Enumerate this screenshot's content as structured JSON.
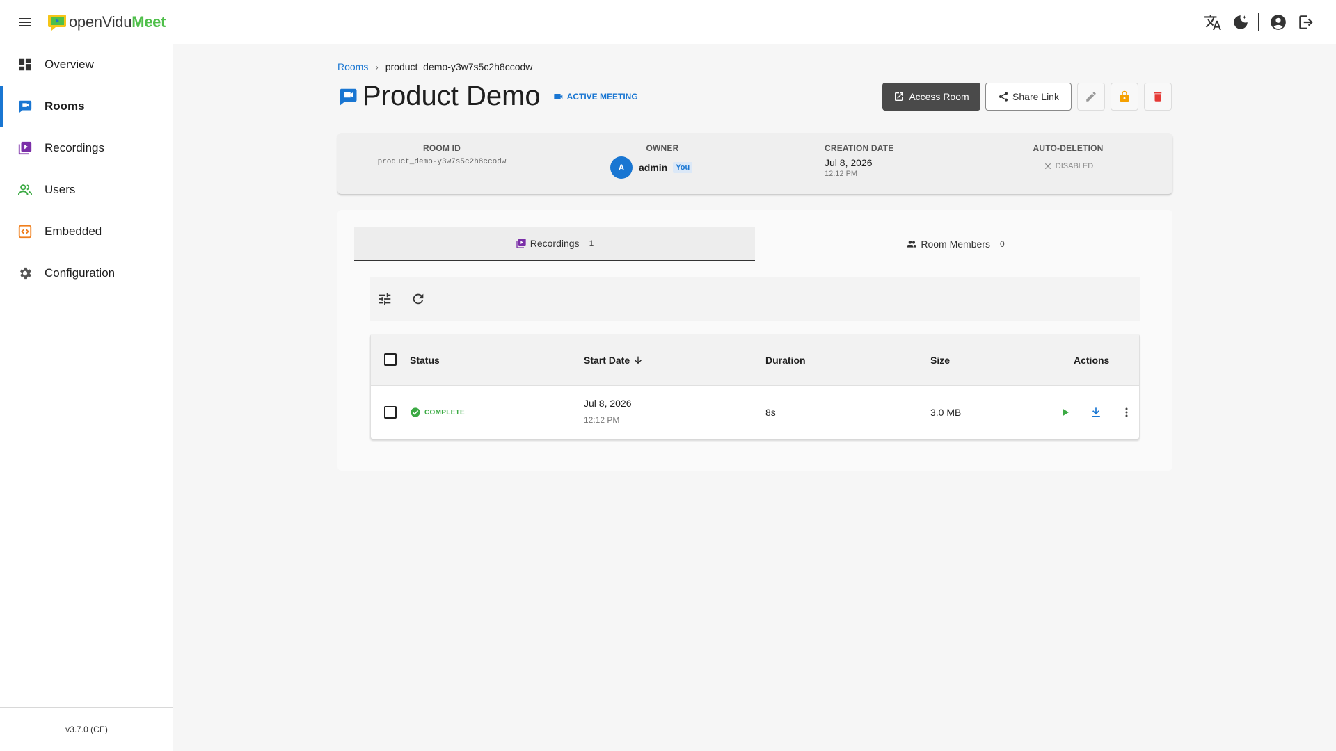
{
  "app": {
    "logo_text_plain": "openVidu",
    "logo_text_bold": "Meet",
    "version": "v3.7.0 (CE)"
  },
  "topbar": {
    "icons": [
      "menu-icon",
      "translate-icon",
      "theme-toggle-icon",
      "account-icon",
      "logout-icon"
    ]
  },
  "sidebar": {
    "items": [
      {
        "label": "Overview",
        "icon": "dashboard-icon",
        "active": false
      },
      {
        "label": "Rooms",
        "icon": "chat-room-icon",
        "active": true
      },
      {
        "label": "Recordings",
        "icon": "video-library-icon",
        "active": false
      },
      {
        "label": "Users",
        "icon": "users-icon",
        "active": false
      },
      {
        "label": "Embedded",
        "icon": "code-icon",
        "active": false
      },
      {
        "label": "Configuration",
        "icon": "gear-icon",
        "active": false
      }
    ]
  },
  "breadcrumb": {
    "root": "Rooms",
    "current": "product_demo-y3w7s5c2h8ccodw"
  },
  "room": {
    "title": "Product Demo",
    "status_badge": "ACTIVE MEETING"
  },
  "header_actions": {
    "access_label": "Access Room",
    "share_label": "Share Link"
  },
  "info": {
    "room_id_label": "ROOM ID",
    "room_id": "product_demo-y3w7s5c2h8ccodw",
    "owner_label": "OWNER",
    "owner_initial": "A",
    "owner_name": "admin",
    "owner_tag": "You",
    "creation_label": "CREATION DATE",
    "creation_date": "Jul 8, 2026",
    "creation_time": "12:12 PM",
    "auto_deletion_label": "AUTO-DELETION",
    "auto_deletion_value": "DISABLED"
  },
  "tabs": [
    {
      "label": "Recordings",
      "count": "1",
      "active": true
    },
    {
      "label": "Room Members",
      "count": "0",
      "active": false
    }
  ],
  "table": {
    "headers": {
      "status": "Status",
      "start_date": "Start Date",
      "duration": "Duration",
      "size": "Size",
      "actions": "Actions"
    },
    "rows": [
      {
        "status": "COMPLETE",
        "start_date": "Jul 8, 2026",
        "start_time": "12:12 PM",
        "duration": "8s",
        "size": "3.0 MB"
      }
    ]
  },
  "colors": {
    "accent": "#1976d2",
    "success": "#3caa44",
    "warning": "#f5a000",
    "danger": "#e53935",
    "recordings_purple": "#7b2fa8",
    "embedded_orange": "#f07f1e",
    "logo_green": "#4fbf4a"
  }
}
